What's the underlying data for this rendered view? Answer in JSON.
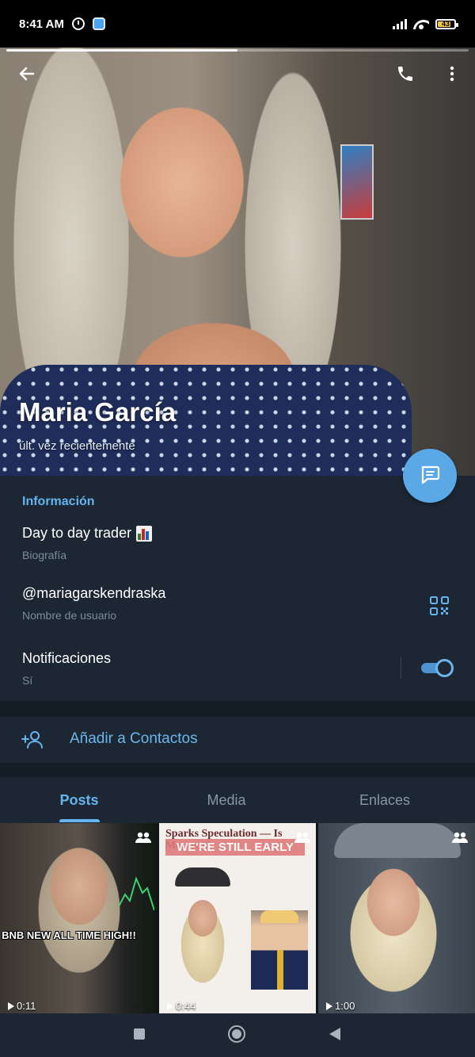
{
  "status_bar": {
    "time": "8:41 AM",
    "battery": "43",
    "icons": [
      "alarm-icon",
      "app-notification-icon",
      "signal-icon",
      "wifi-icon",
      "battery-icon"
    ]
  },
  "profile": {
    "name": "Maria García",
    "last_seen": "últ. vez recientemente",
    "story_progress": 0.5
  },
  "top_bar": {
    "icons": [
      "back-arrow-icon",
      "phone-icon",
      "more-vertical-icon"
    ]
  },
  "fab": {
    "icon": "message-icon"
  },
  "info": {
    "section_title": "Información",
    "bio_value": "Day to day trader",
    "bio_label": "Biografía",
    "username_value": "@mariagarskendraska",
    "username_label": "Nombre de usuario",
    "notifications_value": "Notificaciones",
    "notifications_label": "Sí",
    "notifications_enabled": true
  },
  "add_contact": {
    "label": "Añadir a Contactos"
  },
  "tabs": [
    {
      "label": "Posts",
      "active": true
    },
    {
      "label": "Media",
      "active": false
    },
    {
      "label": "Enlaces",
      "active": false
    }
  ],
  "media": [
    {
      "caption": "BNB NEW ALL TIME HIGH!!",
      "duration": "0:11"
    },
    {
      "headline": "Sparks Speculation — Is Moment?",
      "banner": "WE'RE STILL EARLY",
      "duration": "0:44"
    },
    {
      "duration": "1:00"
    }
  ],
  "colors": {
    "accent": "#64b5ef",
    "background": "#1d2733",
    "fab": "#5aa8e6"
  }
}
